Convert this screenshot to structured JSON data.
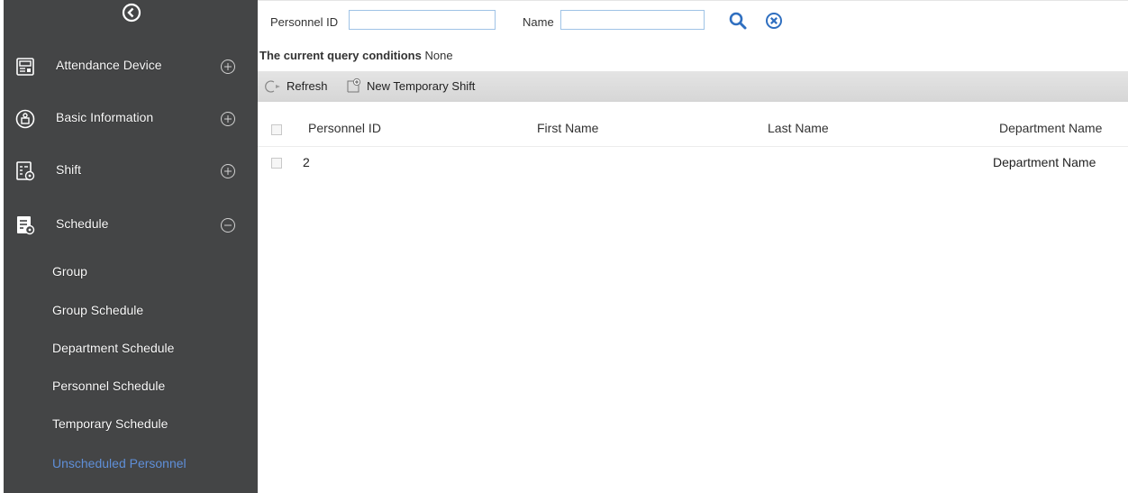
{
  "sidebar": {
    "menu": [
      {
        "label": "Attendance Device",
        "icon": "device-icon",
        "state": "collapsed"
      },
      {
        "label": "Basic Information",
        "icon": "info-icon",
        "state": "collapsed"
      },
      {
        "label": "Shift",
        "icon": "shift-icon",
        "state": "collapsed"
      },
      {
        "label": "Schedule",
        "icon": "schedule-icon",
        "state": "expanded"
      }
    ],
    "submenu": [
      {
        "label": "Group"
      },
      {
        "label": "Group Schedule"
      },
      {
        "label": "Department Schedule"
      },
      {
        "label": "Personnel Schedule"
      },
      {
        "label": "Temporary Schedule"
      },
      {
        "label": "Unscheduled Personnel",
        "active": true
      }
    ]
  },
  "search": {
    "personnel_id_label": "Personnel ID",
    "personnel_id_value": "",
    "name_label": "Name",
    "name_value": ""
  },
  "query": {
    "label": "The current query conditions",
    "value": "None"
  },
  "toolbar": {
    "refresh_label": "Refresh",
    "new_temp_shift_label": "New Temporary Shift"
  },
  "table": {
    "columns": [
      "Personnel ID",
      "First Name",
      "Last Name",
      "Department Name"
    ],
    "rows": [
      {
        "personnel_id": "2",
        "first_name": "",
        "last_name": "",
        "department_name": "Department Name"
      }
    ]
  },
  "colors": {
    "sidebar_bg": "#444546",
    "active_submenu": "#5f8fd8",
    "accent_blue": "#2f6fc0"
  }
}
